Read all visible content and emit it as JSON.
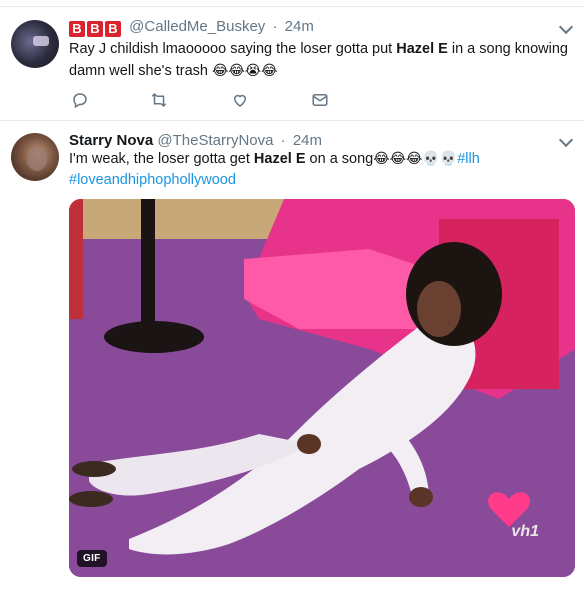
{
  "tweets": [
    {
      "badge_letters": [
        "B",
        "B",
        "B"
      ],
      "handle": "@CalledMe_Buskey",
      "separator": "·",
      "time": "24m",
      "text_before": "Ray J childish lmaooooo saying the loser gotta put ",
      "text_bold": "Hazel E",
      "text_after": " in a song knowing damn well she's trash ",
      "emojis": "😂😂😭😂",
      "actions": [
        "reply-icon",
        "retweet-icon",
        "like-icon",
        "message-icon"
      ]
    },
    {
      "name": "Starry Nova",
      "handle": "@TheStarryNova",
      "separator": "·",
      "time": "24m",
      "text_before": "I'm weak, the loser gotta get ",
      "text_bold": "Hazel E",
      "text_after": " on a song",
      "emojis": "😂😂😂💀💀",
      "hashtag1": "#llh",
      "hashtag2": "#loveandhiphophollywood",
      "media": {
        "gif_label": "GIF",
        "watermark": "vh1"
      }
    }
  ],
  "colors": {
    "link": "#1b95e0",
    "secondary_text": "#657786",
    "badge_red": "#d9232e",
    "divider": "#e6ecf0"
  }
}
